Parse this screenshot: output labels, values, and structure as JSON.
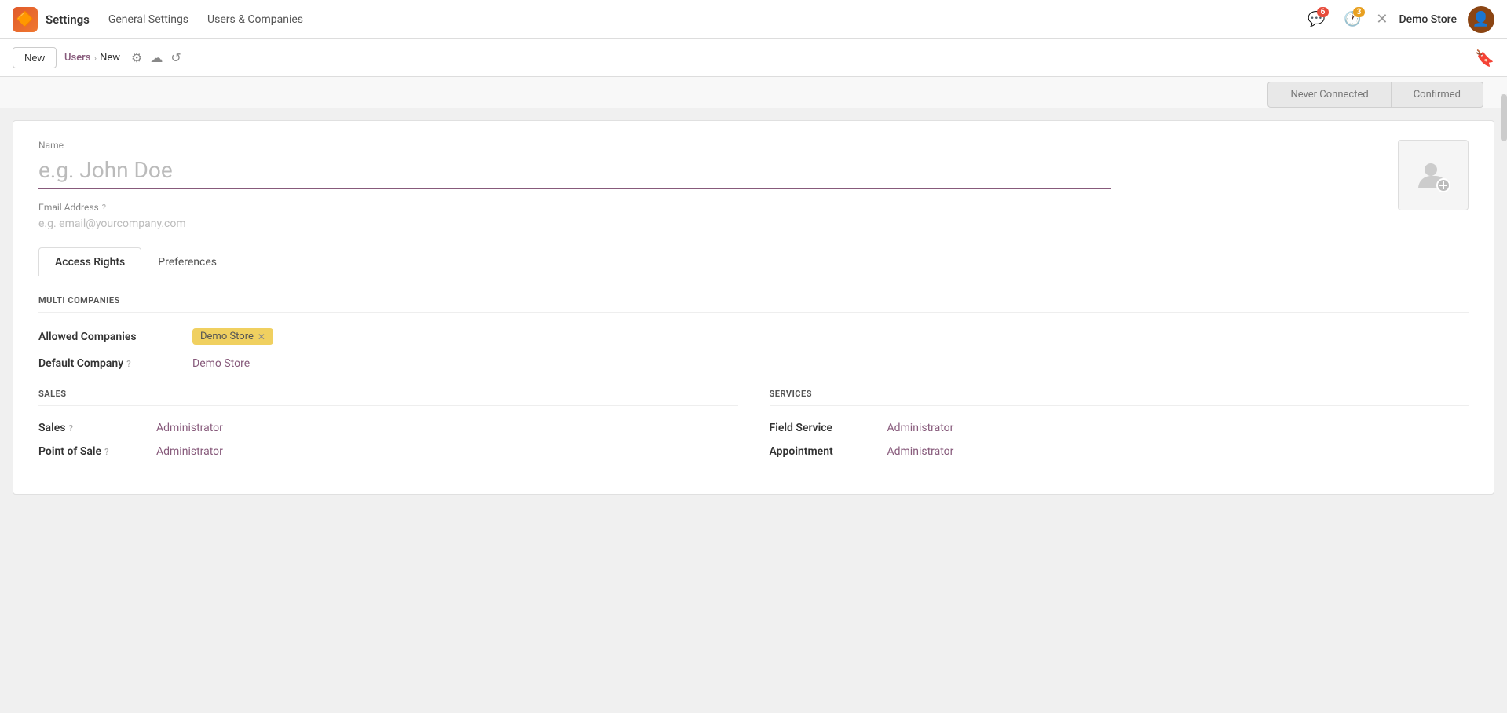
{
  "topnav": {
    "logo": "◉",
    "app_name": "Settings",
    "links": [
      {
        "label": "General Settings"
      },
      {
        "label": "Users & Companies"
      }
    ],
    "notifications": [
      {
        "icon": "💬",
        "count": "6",
        "badge_type": "red"
      },
      {
        "icon": "🕐",
        "count": "3",
        "badge_type": "gold"
      }
    ],
    "store_name": "Demo Store",
    "x_icon": "✕"
  },
  "toolbar": {
    "new_button": "New",
    "breadcrumb_parent": "Users",
    "breadcrumb_current": "New",
    "bookmark_icon": "🔖"
  },
  "statusbar": {
    "steps": [
      {
        "label": "Never Connected",
        "active": false
      },
      {
        "label": "Confirmed",
        "active": false
      }
    ]
  },
  "form": {
    "name_label": "Name",
    "name_placeholder": "e.g. John Doe",
    "email_label": "Email Address",
    "email_placeholder": "e.g. email@yourcompany.com",
    "avatar_icon": "📷"
  },
  "tabs": [
    {
      "label": "Access Rights",
      "active": true
    },
    {
      "label": "Preferences",
      "active": false
    }
  ],
  "access_rights": {
    "multi_companies_header": "MULTI COMPANIES",
    "allowed_companies_label": "Allowed Companies",
    "allowed_companies_tag": "Demo Store",
    "default_company_label": "Default Company",
    "default_company_value": "Demo Store",
    "sales_header": "SALES",
    "services_header": "SERVICES",
    "sales_fields": [
      {
        "label": "Sales",
        "value": "Administrator"
      },
      {
        "label": "Point of Sale",
        "value": "Administrator"
      }
    ],
    "services_fields": [
      {
        "label": "Field Service",
        "value": "Administrator"
      },
      {
        "label": "Appointment",
        "value": "Administrator"
      }
    ]
  }
}
